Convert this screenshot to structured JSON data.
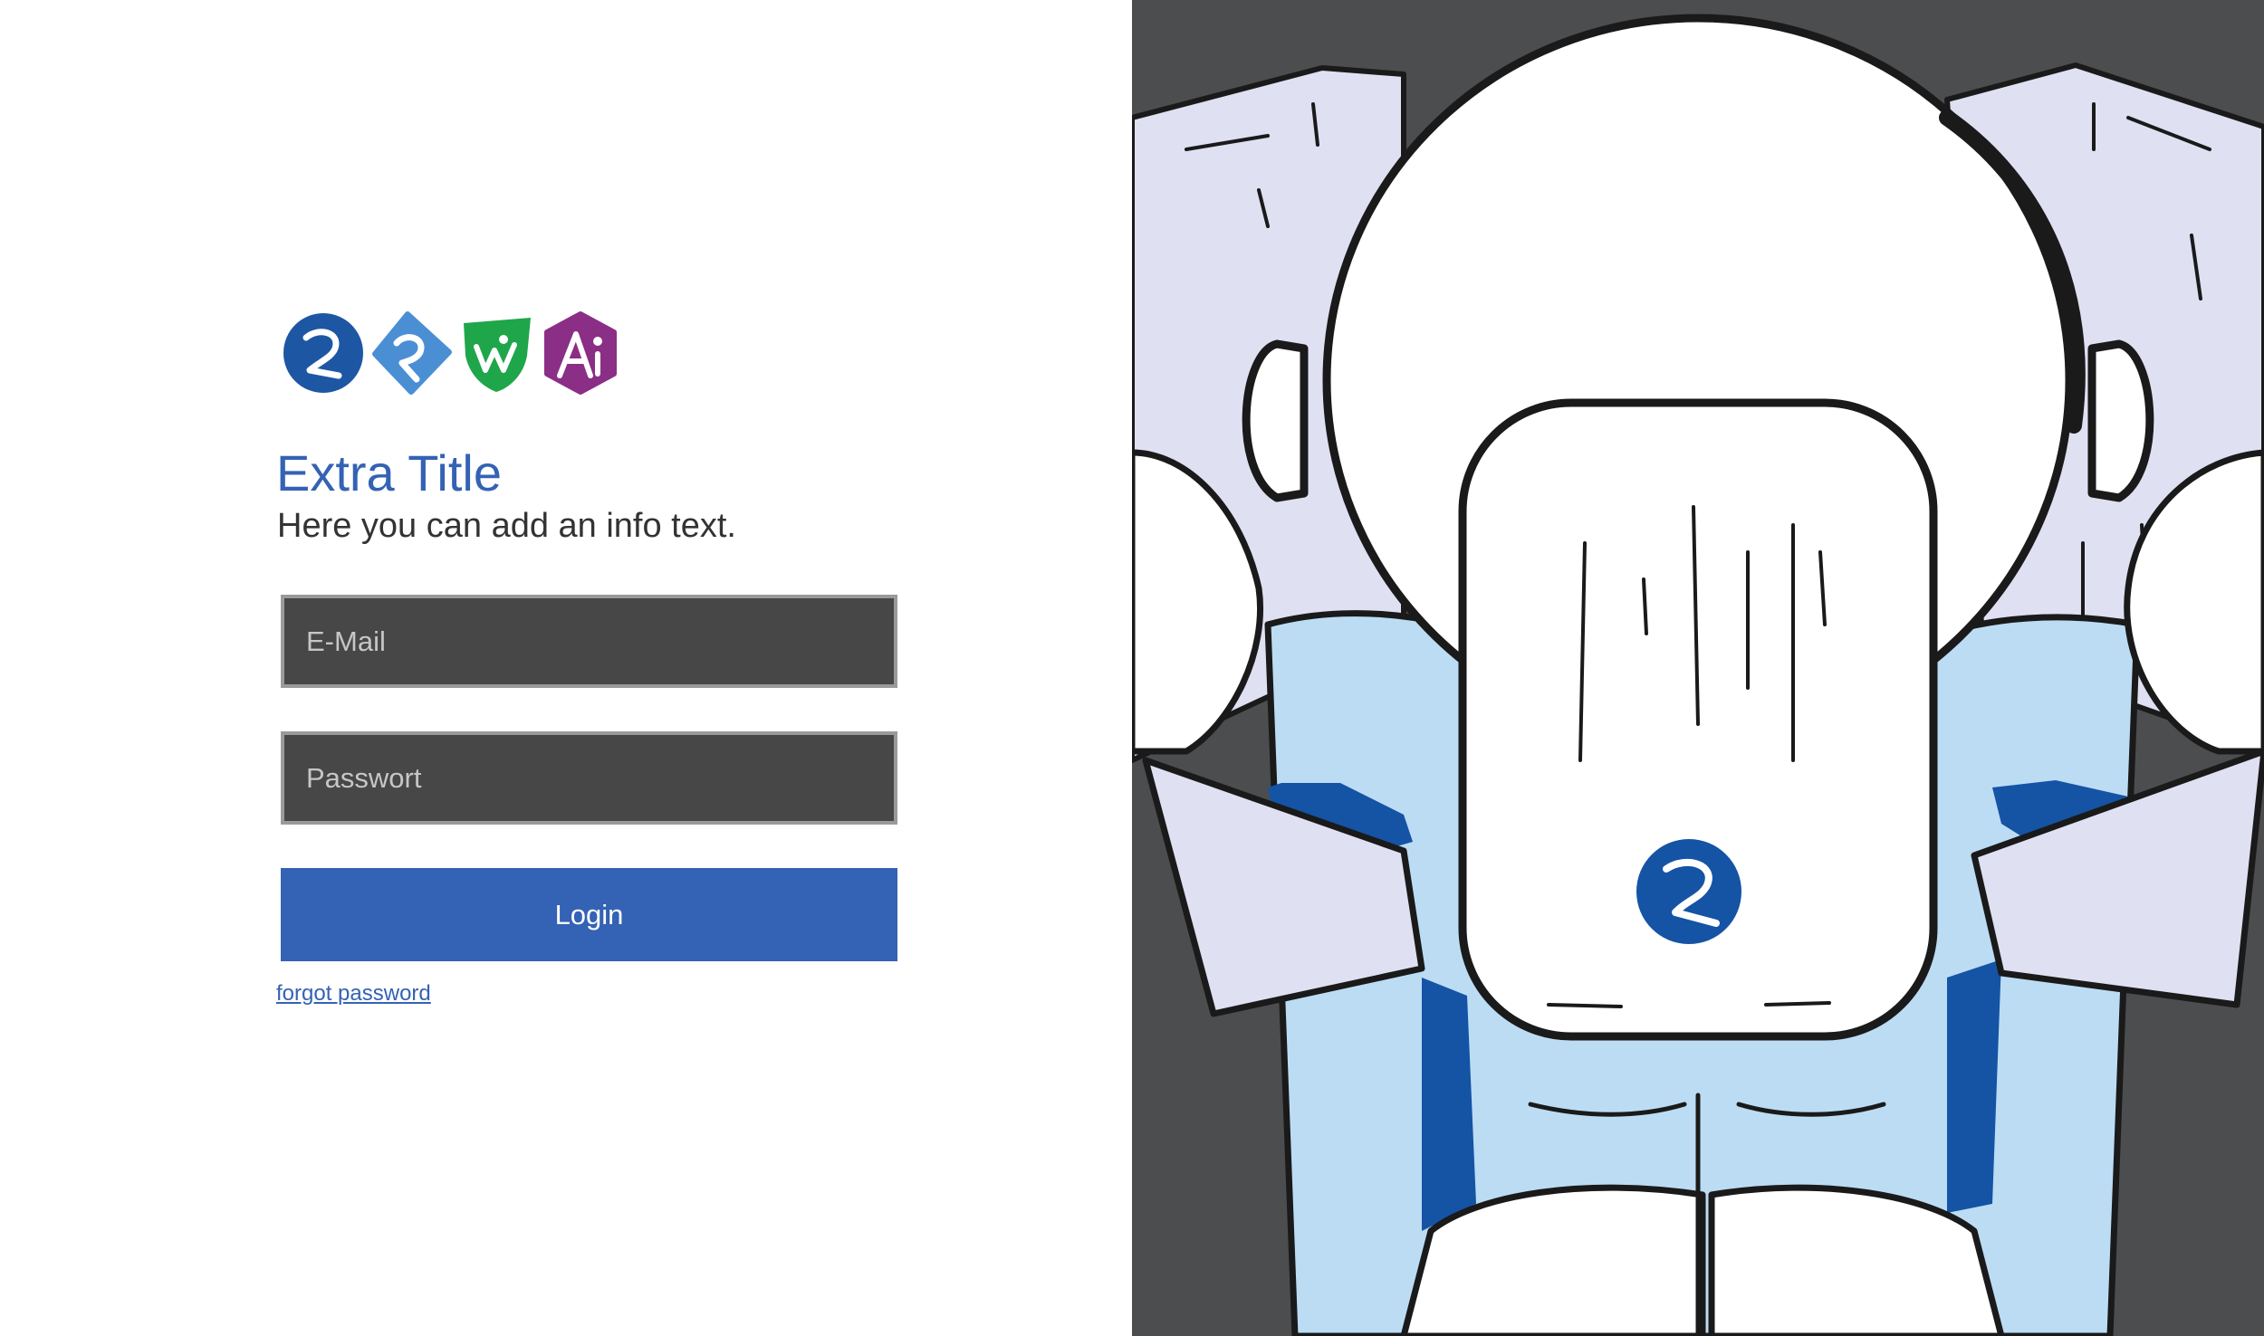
{
  "brand": {
    "logos": [
      {
        "icon": "logo-r-circle-icon",
        "color": "#1d57a4"
      },
      {
        "icon": "logo-r-diamond-icon",
        "color": "#4a8fd4"
      },
      {
        "icon": "logo-wi-shield-icon",
        "color": "#1fa64a"
      },
      {
        "icon": "logo-ai-hexagon-icon",
        "color": "#8b2e86"
      }
    ]
  },
  "header": {
    "title": "Extra Title",
    "info": "Here you can add an info text."
  },
  "form": {
    "email_placeholder": "E-Mail",
    "password_placeholder": "Passwort",
    "login_label": "Login",
    "forgot_label": "forgot password"
  },
  "illustration": {
    "subject": "robot-character-illustration",
    "chest_logo_icon": "logo-r-circle-icon"
  },
  "colors": {
    "accent": "#3462b4",
    "input_bg": "#474747",
    "illustration_bg": "#4c4d4f",
    "robot_body": "#bcdcf4",
    "robot_accent": "#1553a5",
    "wall": "#dfe0f2"
  }
}
